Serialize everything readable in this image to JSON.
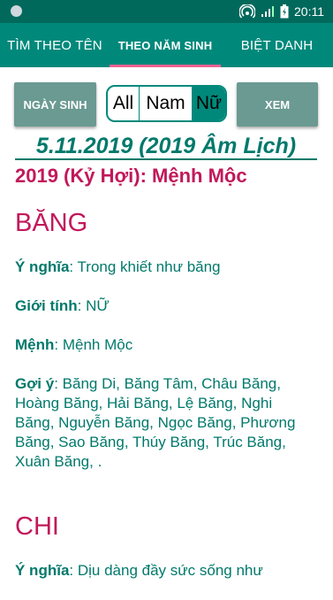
{
  "status": {
    "time": "20:11"
  },
  "tabs": [
    {
      "label": "TÌM THEO TÊN"
    },
    {
      "label": "THEO NĂM SINH"
    },
    {
      "label": "BIỆT DANH"
    }
  ],
  "controls": {
    "date_button": "NGÀY SINH",
    "view_button": "XEM",
    "gender_options": [
      "All",
      "Nam",
      "Nữ"
    ],
    "gender_selected": "Nữ"
  },
  "heading": "5.11.2019 (2019 Âm Lịch)",
  "subtitle": "2019 (Kỷ Hợi): Mệnh Mộc",
  "labels": {
    "meaning": "Ý nghĩa",
    "gender": "Giới tính",
    "element": "Mệnh",
    "suggest": "Gợi ý"
  },
  "entries": [
    {
      "name": "BĂNG",
      "meaning": ": Trong khiết như băng",
      "gender": ": NỮ",
      "element": ": Mệnh Mộc",
      "suggest": ": Băng Di, Băng Tâm, Châu Băng, Hoàng Băng, Hải Băng, Lệ Băng, Nghi Băng, Nguyễn Băng, Ngọc Băng, Phương Băng, Sao Băng, Thúy Băng, Trúc Băng, Xuân Băng, ."
    },
    {
      "name": "CHI",
      "meaning": ": Dịu dàng đầy sức sống như"
    }
  ],
  "colors": {
    "primary": "#00897b",
    "accent": "#c2185b",
    "indicator": "#f06292"
  }
}
